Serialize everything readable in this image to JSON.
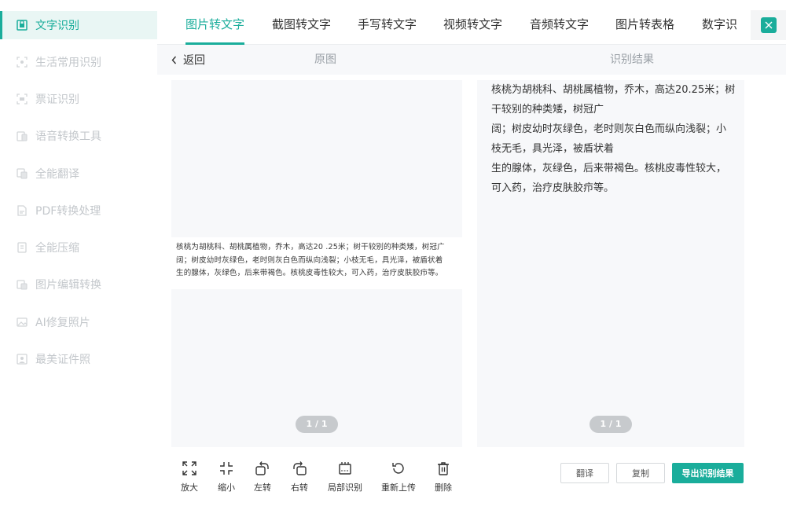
{
  "sidebar": {
    "items": [
      {
        "label": "文字识别",
        "icon": "text-recognition-icon",
        "active": true
      },
      {
        "label": "生活常用识别",
        "icon": "life-scan-icon"
      },
      {
        "label": "票证识别",
        "icon": "ticket-scan-icon"
      },
      {
        "label": "语音转换工具",
        "icon": "voice-convert-icon"
      },
      {
        "label": "全能翻译",
        "icon": "translate-icon"
      },
      {
        "label": "PDF转换处理",
        "icon": "pdf-icon"
      },
      {
        "label": "全能压缩",
        "icon": "compress-icon"
      },
      {
        "label": "图片编辑转换",
        "icon": "image-edit-icon"
      },
      {
        "label": "AI修复照片",
        "icon": "ai-repair-icon"
      },
      {
        "label": "最美证件照",
        "icon": "id-photo-icon"
      }
    ]
  },
  "tabs": [
    {
      "label": "图片转文字",
      "active": true
    },
    {
      "label": "截图转文字"
    },
    {
      "label": "手写转文字"
    },
    {
      "label": "视频转文字"
    },
    {
      "label": "音频转文字"
    },
    {
      "label": "图片转表格"
    },
    {
      "label": "数字识"
    }
  ],
  "subheader": {
    "back_label": "返回",
    "original_title": "原图",
    "result_title": "识别结果"
  },
  "original_doc": {
    "lines": [
      "核桃为胡桃科、胡桃属植物，乔木，高达20 .25米；树干较别的种类矮，树冠广",
      "阔；树皮幼时灰绿色，老时则灰白色而纵向浅裂；小枝无毛，具光泽，被盾状着",
      "生的腺体，灰绿色，后来带褐色。核桃皮毒性较大，可入药，治疗皮肤胶疖等。"
    ]
  },
  "result": {
    "lines": [
      "核桃为胡桃科、胡桃属植物，乔木，高达20.25米；树",
      "干较别的种类矮，树冠广",
      "阔；树皮幼时灰绿色，老时则灰白色而纵向浅裂；小",
      "枝无毛，具光泽，被盾状着",
      "生的腺体，灰绿色，后来带褐色。核桃皮毒性较大，",
      "可入药，治疗皮肤胶疖等。"
    ]
  },
  "pager": {
    "left": "1 / 1",
    "right": "1 / 1"
  },
  "toolbar": {
    "zoom_in": "放大",
    "zoom_out": "缩小",
    "rotate_left": "左转",
    "rotate_right": "右转",
    "partial_recognize": "局部识别",
    "reupload": "重新上传",
    "delete": "删除"
  },
  "actions": {
    "translate": "翻译",
    "copy": "复制",
    "export": "导出识别结果"
  },
  "colors": {
    "accent": "#1aad9b",
    "sidebar_active_bg": "#e9f6f4",
    "panel_bg": "#f7f8fa"
  }
}
